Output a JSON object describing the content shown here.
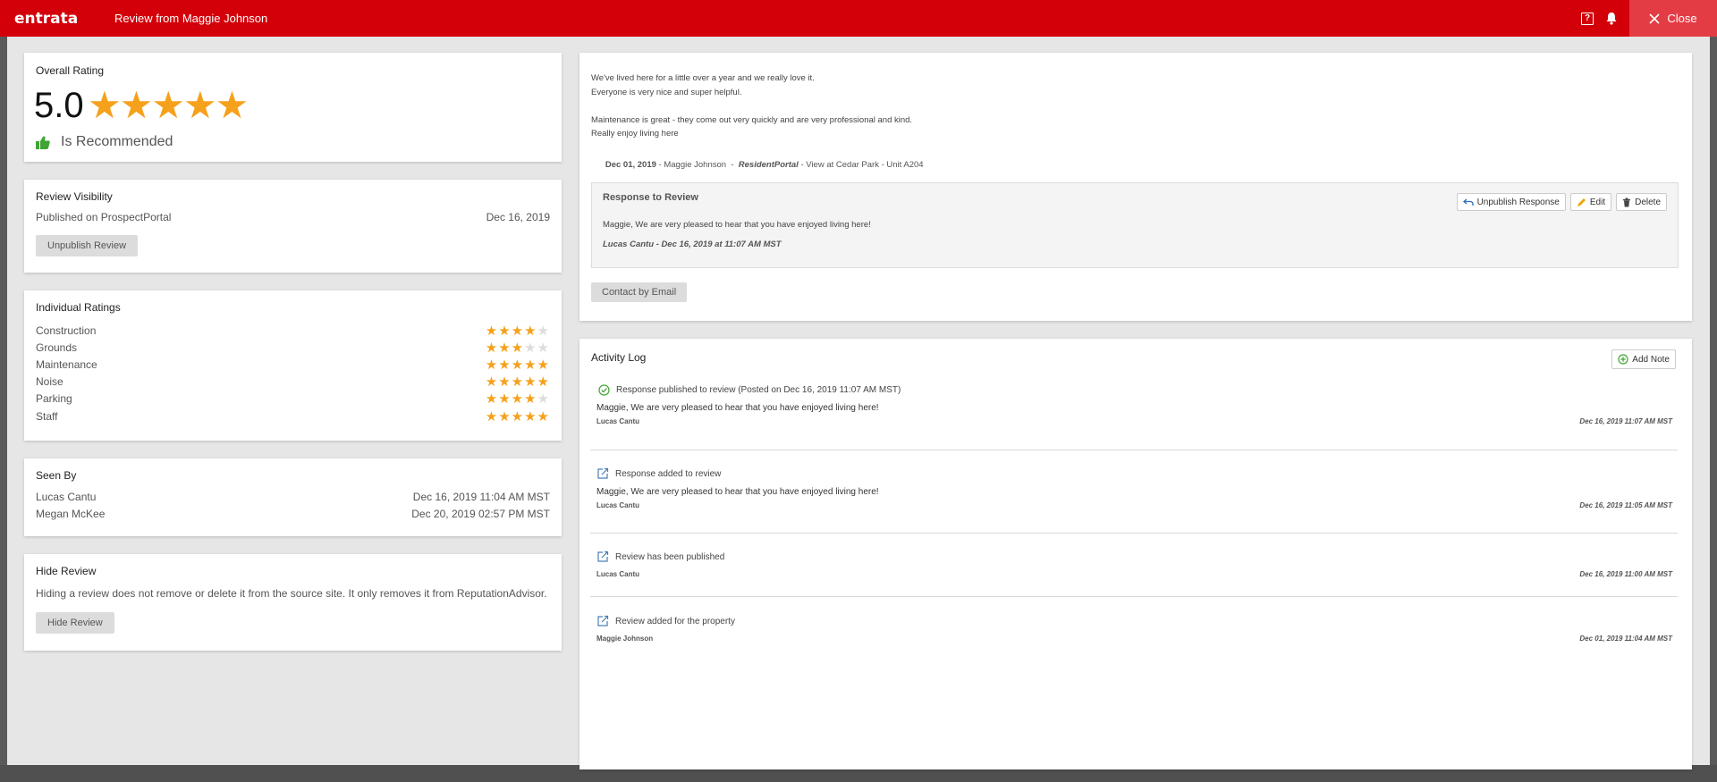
{
  "header": {
    "logo": "entrata",
    "title": "Review from Maggie Johnson",
    "help_icon": "?",
    "close_label": "Close"
  },
  "overall": {
    "title": "Overall Rating",
    "score": "5.0",
    "stars": 5,
    "recommended_label": "Is Recommended"
  },
  "visibility": {
    "title": "Review Visibility",
    "published_label": "Published on ProspectPortal",
    "published_date": "Dec 16, 2019",
    "unpublish_label": "Unpublish Review"
  },
  "individual": {
    "title": "Individual Ratings",
    "items": [
      {
        "label": "Construction",
        "stars": 4
      },
      {
        "label": "Grounds",
        "stars": 3
      },
      {
        "label": "Maintenance",
        "stars": 5
      },
      {
        "label": "Noise",
        "stars": 5
      },
      {
        "label": "Parking",
        "stars": 4
      },
      {
        "label": "Staff",
        "stars": 5
      }
    ]
  },
  "seen_by": {
    "title": "Seen By",
    "items": [
      {
        "name": "Lucas Cantu",
        "date": "Dec 16, 2019 11:04 AM MST"
      },
      {
        "name": "Megan McKee",
        "date": "Dec 20, 2019 02:57 PM MST"
      }
    ]
  },
  "hide": {
    "title": "Hide Review",
    "description": "Hiding a review does not remove or delete it from the source site. It only removes it from ReputationAdvisor.",
    "button_label": "Hide Review"
  },
  "review": {
    "lines": [
      "We've lived here for a little over a year and we really love it.",
      "Everyone is very nice and super helpful.",
      "Maintenance is great - they come out very quickly and are very professional and kind.",
      "Really enjoy living here"
    ],
    "meta_date": "Dec 01, 2019",
    "meta_author": " - Maggie Johnson  -  ",
    "meta_source": "ResidentPortal",
    "meta_location": " - View at Cedar Park - Unit A204",
    "response": {
      "title": "Response to Review",
      "unpublish_label": "Unpublish Response",
      "edit_label": "Edit",
      "delete_label": "Delete",
      "message": "Maggie, We are very pleased to hear that you have enjoyed living here!",
      "signature": "Lucas Cantu - Dec 16, 2019 at 11:07 AM MST"
    },
    "contact_label": "Contact by Email"
  },
  "activity": {
    "title": "Activity Log",
    "add_note_label": "Add Note",
    "items": [
      {
        "icon": "check-circle-icon",
        "heading": "Response published to review (Posted on Dec 16, 2019 11:07 AM MST)",
        "message": "Maggie, We are very pleased to hear that you have enjoyed living here!",
        "author": "Lucas Cantu",
        "date": "Dec 16, 2019 11:07 AM MST"
      },
      {
        "icon": "external-edit-icon",
        "heading": "Response added to review",
        "message": "Maggie, We are very pleased to hear that you have enjoyed living here!",
        "author": "Lucas Cantu",
        "date": "Dec 16, 2019 11:05 AM MST"
      },
      {
        "icon": "external-edit-icon",
        "heading": "Review has been published",
        "message": "",
        "author": "Lucas Cantu",
        "date": "Dec 16, 2019 11:00 AM MST"
      },
      {
        "icon": "external-edit-icon",
        "heading": "Review added for the property",
        "message": "",
        "author": "Maggie Johnson",
        "date": "Dec 01, 2019 11:04 AM MST"
      }
    ]
  },
  "colors": {
    "brand_red": "#d3000a",
    "star_gold": "#f5a11c",
    "recommend_green": "#3fa535"
  }
}
